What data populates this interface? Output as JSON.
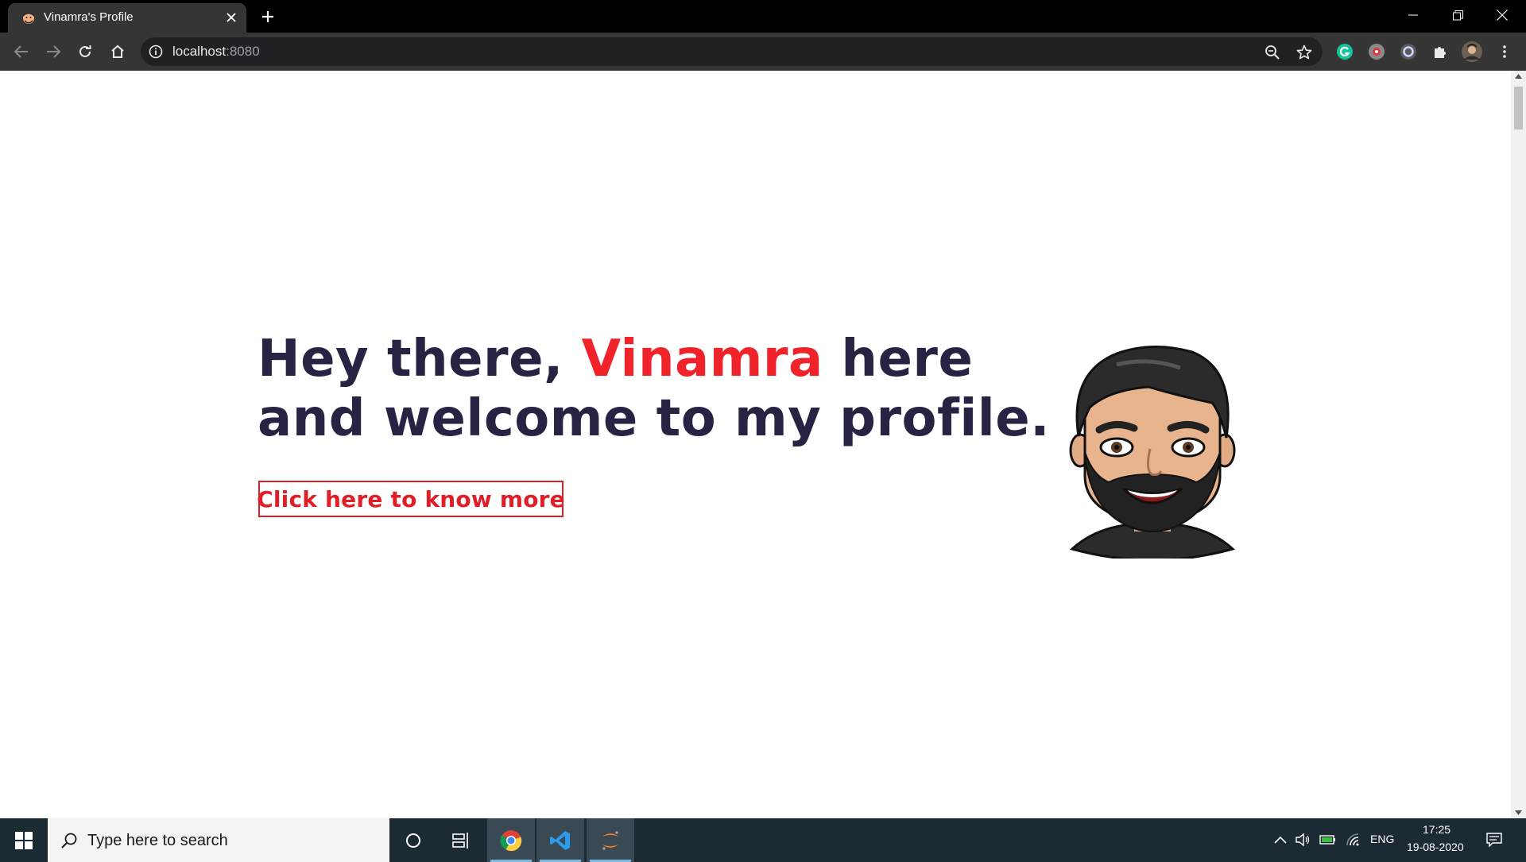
{
  "browser": {
    "tab_title": "Vinamra's Profile",
    "url_host": "localhost",
    "url_port": ":8080",
    "icons": {
      "back": "arrow-left-icon",
      "forward": "arrow-right-icon",
      "reload": "reload-icon",
      "home": "home-icon",
      "site_info": "info-icon",
      "zoom": "zoom-out-icon",
      "bookmark": "star-icon",
      "extensions": [
        "grammarly-icon",
        "extension-red-icon",
        "extension-ring-icon",
        "puzzle-icon"
      ],
      "profile": "profile-avatar",
      "menu": "kebab-menu-icon"
    }
  },
  "page": {
    "headline_part1": "Hey there, ",
    "headline_name": "Vinamra",
    "headline_part2": " here",
    "headline_line2": "and welcome to my profile.",
    "cta_label": "Click here to know more",
    "colors": {
      "heading": "#262442",
      "accent": "#f0232a",
      "button": "#e01e27"
    }
  },
  "taskbar": {
    "search_placeholder": "Type here to search",
    "apps": [
      "cortana-icon",
      "task-view-icon",
      "chrome-icon",
      "vscode-icon",
      "jupyter-icon"
    ],
    "language": "ENG",
    "time": "17:25",
    "date": "19-08-2020"
  }
}
